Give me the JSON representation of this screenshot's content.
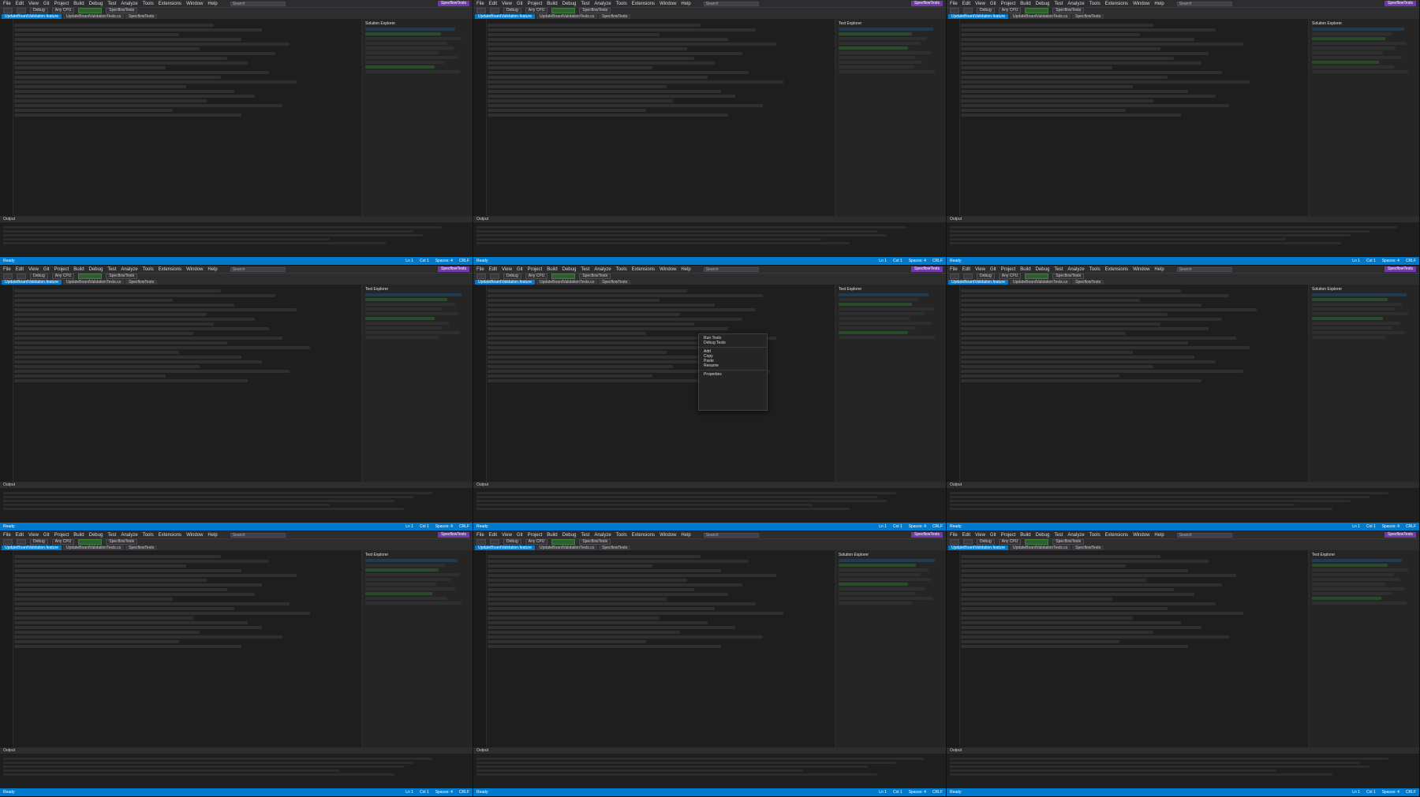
{
  "menu": [
    "File",
    "Edit",
    "View",
    "Git",
    "Project",
    "Build",
    "Debug",
    "Test",
    "Analyze",
    "Tools",
    "Extensions",
    "Window",
    "Help"
  ],
  "search_placeholder": "Search",
  "brand_label": "SpecflowTests",
  "toolbar": {
    "config": "Debug",
    "platform": "Any CPU",
    "start_label": "SpecflowTests"
  },
  "tab_labels": [
    "UpdateBoardValidation.feature",
    "UpdateBoardValidationTests.cs",
    "SpecflowTests"
  ],
  "right_titles": [
    "Solution Explorer",
    "Test Explorer",
    "Solution Explorer",
    "Test Explorer",
    "Test Explorer",
    "Solution Explorer",
    "Test Explorer",
    "Solution Explorer",
    "Test Explorer"
  ],
  "output_title": "Output",
  "status_left": "Ready",
  "status_right": [
    "Ln 1",
    "Col 1",
    "Spaces: 4",
    "CRLF"
  ],
  "context_menu_items": [
    "Run Tests",
    "Debug Tests",
    "Add",
    "Copy",
    "Paste",
    "Rename",
    "Properties"
  ]
}
